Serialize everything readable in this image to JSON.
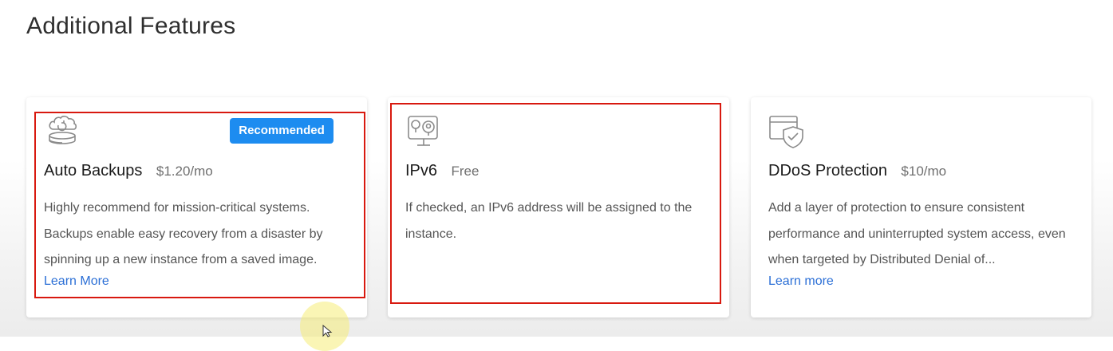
{
  "page": {
    "heading": "Additional Features"
  },
  "cards": [
    {
      "icon": "backup-icon",
      "title": "Auto Backups",
      "price": "$1.20/mo",
      "badge": "Recommended",
      "description": "Highly recommend for mission-critical systems. Backups enable easy recovery from a disaster by spinning up a new instance from a saved image.",
      "link": "Learn More"
    },
    {
      "icon": "ipv6-network-icon",
      "title": "IPv6",
      "price": "Free",
      "description": "If checked, an IPv6 address will be assigned to the instance."
    },
    {
      "icon": "ddos-shield-icon",
      "title": "DDoS Protection",
      "price": "$10/mo",
      "description": "Add a layer of protection to ensure consistent performance and uninterrupted system access, even when targeted by Distributed Denial of...",
      "link": "Learn more"
    }
  ],
  "colors": {
    "accent": "#1d8cf0",
    "link": "#2b6fd6",
    "highlight": "#d8190f"
  }
}
